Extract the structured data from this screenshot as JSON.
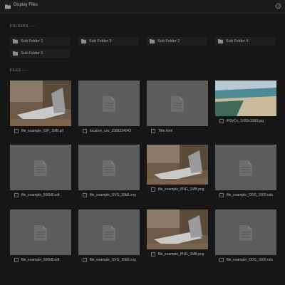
{
  "window": {
    "title": "Display Files"
  },
  "sections": {
    "folders_label": "FOLDERS ----",
    "files_label": "FILES ----"
  },
  "folders": [
    {
      "label": "Sub Folder 1"
    },
    {
      "label": "Sub Folder 3"
    },
    {
      "label": "Sub Folder 2"
    },
    {
      "label": "Sub Folder 4"
    },
    {
      "label": "Sub Folder 5"
    }
  ],
  "files": [
    {
      "name": "file_example_GIF_1MB.gif",
      "kind": "image-laptop"
    },
    {
      "name": "location_csv_1588334043",
      "kind": "document"
    },
    {
      "name": "Title.html",
      "kind": "document"
    },
    {
      "name": "iR3yCn_1920x1080.jpg",
      "kind": "image-beach"
    },
    {
      "name": "file_example_500kB.odt",
      "kind": "document"
    },
    {
      "name": "file_example_SVG_30kB.svg",
      "kind": "document"
    },
    {
      "name": "file_example_PNG_1MB.png",
      "kind": "image-laptop"
    },
    {
      "name": "file_example_ODS_1000.ods",
      "kind": "document"
    },
    {
      "name": "file_example_500kB.odt",
      "kind": "document"
    },
    {
      "name": "file_example_SVG_30kB.svg",
      "kind": "document"
    },
    {
      "name": "file_example_PNG_1MB.png",
      "kind": "image-laptop"
    },
    {
      "name": "file_example_ODS_1000.ods",
      "kind": "document"
    }
  ],
  "colors": {
    "background": "#161616",
    "tile": "#5c5c5c",
    "folder_bg": "#1f1f1f"
  }
}
